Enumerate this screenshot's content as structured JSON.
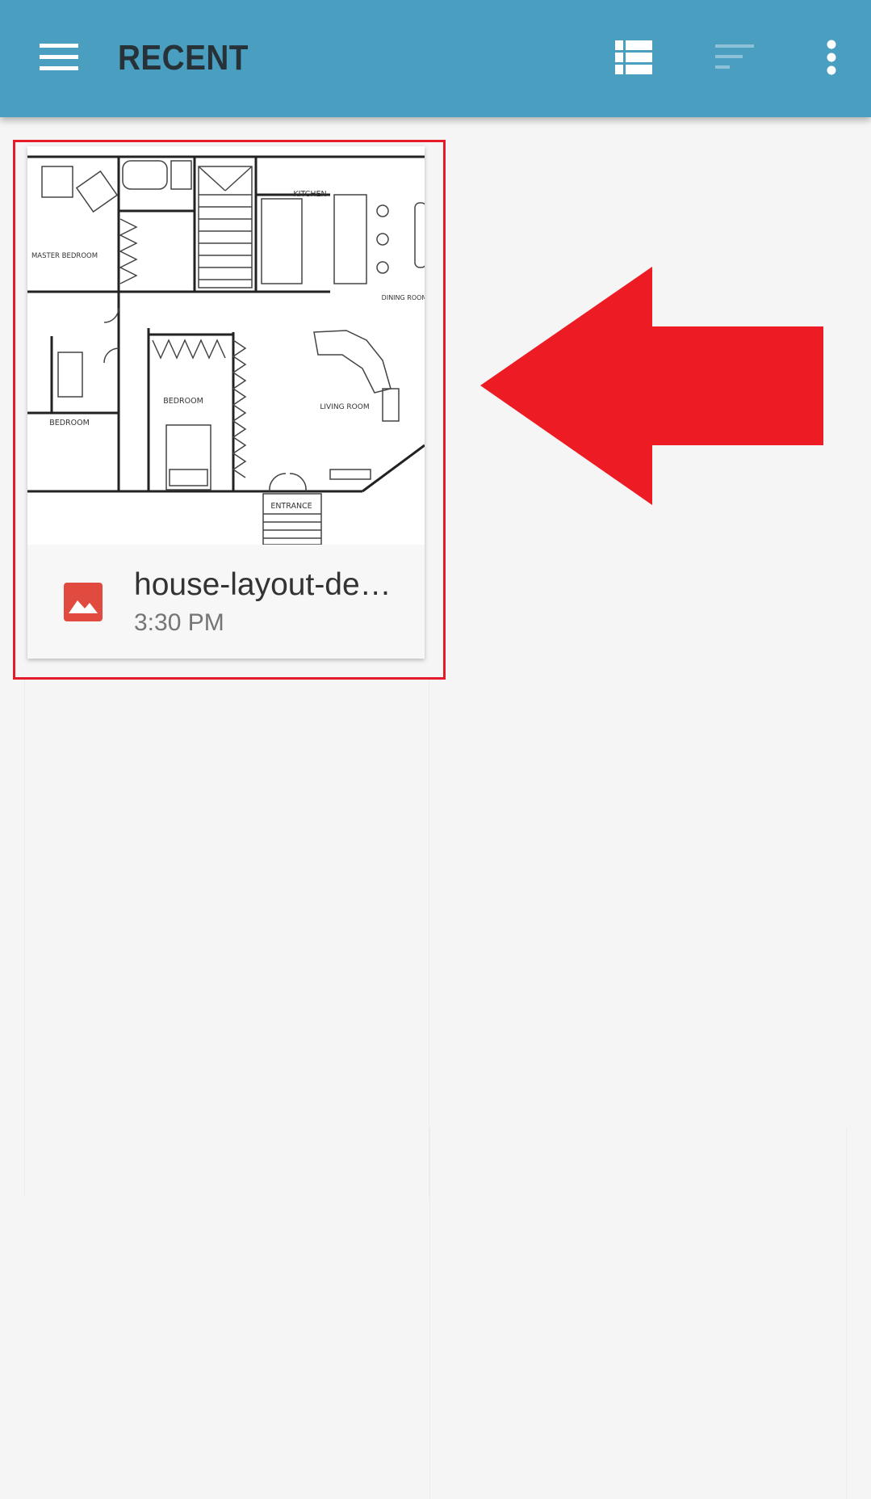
{
  "header": {
    "title": "RECENT",
    "icons": {
      "menu": "menu-icon",
      "view": "list-view-icon",
      "sort": "sort-icon",
      "more": "more-vert-icon"
    }
  },
  "files": [
    {
      "name": "house-layout-de…",
      "time": "3:30 PM",
      "type_icon": "image-icon",
      "thumbnail_labels": {
        "master_bedroom": "MASTER BEDROOM",
        "kitchen": "KITCHEN",
        "dining_room": "DINING ROOM",
        "bedroom_left": "BEDROOM",
        "bedroom_center": "BEDROOM",
        "living_room": "LIVING ROOM",
        "entrance": "ENTRANCE"
      }
    }
  ],
  "colors": {
    "toolbar": "#4a9ec0",
    "title": "#263238",
    "highlight": "#e31b2a",
    "file_icon": "#e04a3f",
    "background": "#f5f5f5"
  }
}
